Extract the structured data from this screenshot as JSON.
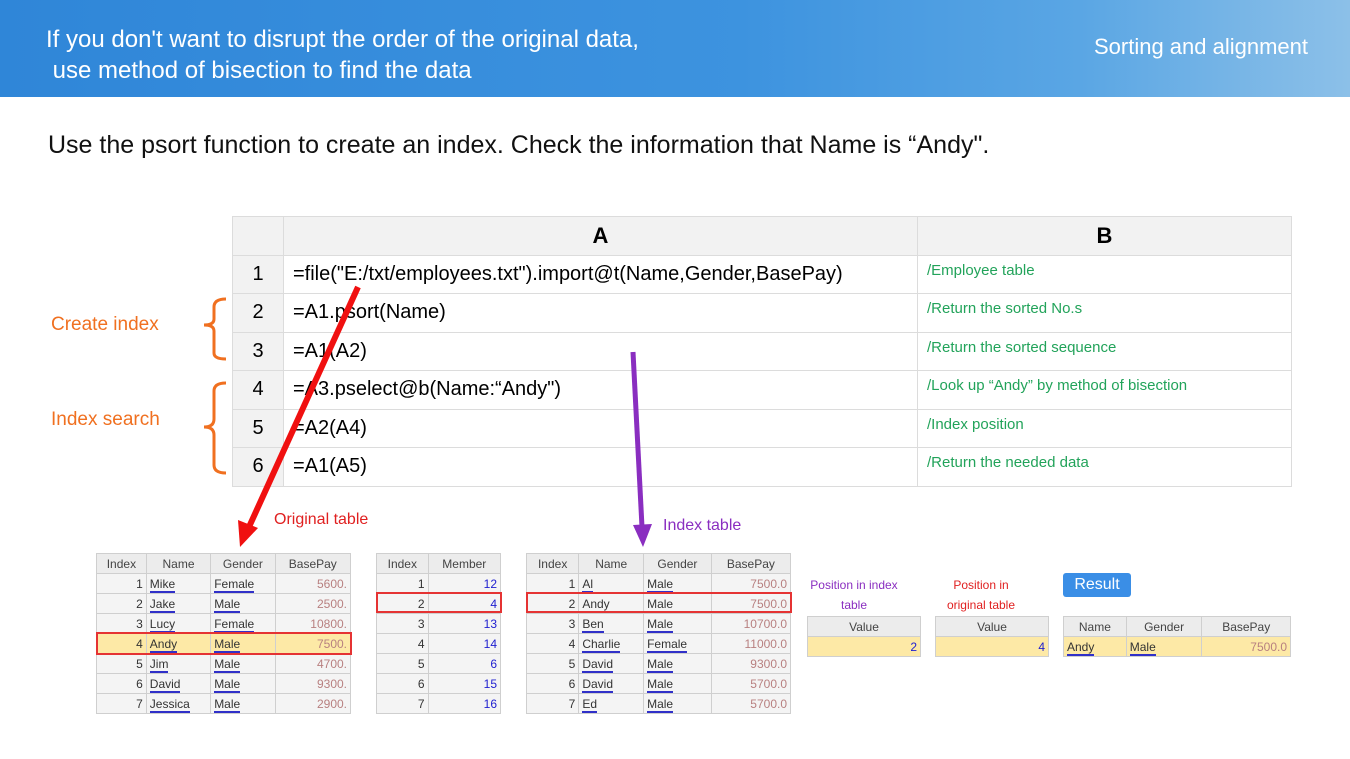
{
  "header": {
    "title": "If you don't want to disrupt the order of the original data,\n use method of bisection to find the data",
    "section": "Sorting and alignment"
  },
  "subtitle": "Use the psort function to create an index. Check the information that Name is “Andy\".",
  "grid": {
    "col_headers": [
      "A",
      "B"
    ],
    "rows": [
      {
        "n": "1",
        "a": "=file(\"E:/txt/employees.txt\").import@t(Name,Gender,BasePay)",
        "b": "/Employee table"
      },
      {
        "n": "2",
        "a": "=A1.psort(Name)",
        "b": "/Return  the sorted No.s"
      },
      {
        "n": "3",
        "a": "=A1(A2)",
        "b": "/Return  the sorted sequence"
      },
      {
        "n": "4",
        "a": "=A3.pselect@b(Name:“Andy\")",
        "b": "/Look up “Andy” by method of bisection"
      },
      {
        "n": "5",
        "a": "=A2(A4)",
        "b": "/Index  position"
      },
      {
        "n": "6",
        "a": "=A1(A5)",
        "b": "/Return  the needed data"
      }
    ]
  },
  "labels": {
    "create_index": "Create index",
    "index_search": "Index search",
    "original_table": "Original table",
    "index_table": "Index table",
    "pos_index": "Position in index table",
    "pos_original": "Position in original table",
    "result_button": "Result"
  },
  "original": {
    "headers": [
      "Index",
      "Name",
      "Gender",
      "BasePay"
    ],
    "rows": [
      [
        "1",
        "Mike",
        "Female",
        "5600."
      ],
      [
        "2",
        "Jake",
        "Male",
        "2500."
      ],
      [
        "3",
        "Lucy",
        "Female",
        "10800."
      ],
      [
        "4",
        "Andy",
        "Male",
        "7500."
      ],
      [
        "5",
        "Jim",
        "Male",
        "4700."
      ],
      [
        "6",
        "David",
        "Male",
        "9300."
      ],
      [
        "7",
        "Jessica",
        "Male",
        "2900."
      ]
    ]
  },
  "psort": {
    "headers": [
      "Index",
      "Member"
    ],
    "rows": [
      [
        "1",
        "12"
      ],
      [
        "2",
        "4"
      ],
      [
        "3",
        "13"
      ],
      [
        "4",
        "14"
      ],
      [
        "5",
        "6"
      ],
      [
        "6",
        "15"
      ],
      [
        "7",
        "16"
      ]
    ]
  },
  "indexed": {
    "headers": [
      "Index",
      "Name",
      "Gender",
      "BasePay"
    ],
    "rows": [
      [
        "1",
        "Al",
        "Male",
        "7500.0"
      ],
      [
        "2",
        "Andy",
        "Male",
        "7500.0"
      ],
      [
        "3",
        "Ben",
        "Male",
        "10700.0"
      ],
      [
        "4",
        "Charlie",
        "Female",
        "11000.0"
      ],
      [
        "5",
        "David",
        "Male",
        "9300.0"
      ],
      [
        "6",
        "David",
        "Male",
        "5700.0"
      ],
      [
        "7",
        "Ed",
        "Male",
        "5700.0"
      ]
    ]
  },
  "value1": {
    "header": "Value",
    "value": "2"
  },
  "value2": {
    "header": "Value",
    "value": "4"
  },
  "result": {
    "headers": [
      "Name",
      "Gender",
      "BasePay"
    ],
    "row": [
      "Andy",
      "Male",
      "7500.0"
    ]
  }
}
